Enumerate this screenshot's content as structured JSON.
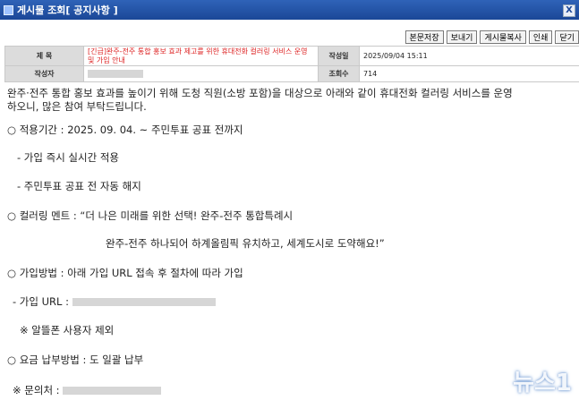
{
  "window": {
    "title": "게시물 조회[ 공지사항 ]",
    "close": "X"
  },
  "toolbar": {
    "buttons": [
      "본문저장",
      "보내기",
      "게시물복사",
      "인쇄",
      "닫기"
    ]
  },
  "info": {
    "title_label": "제 목",
    "title_value": "[긴급]완주-전주 통합 홍보 효과 제고를 위한 휴대전화 컬러링 서비스 운영 및 가입 안내",
    "date_label": "작성일",
    "date_value": "2025/09/04 15:11",
    "author_label": "작성자",
    "author_value": "",
    "views_label": "조회수",
    "views_value": "714"
  },
  "body": {
    "intro1": "완주·전주 통합 홍보 효과를 높이기 위해 도청 직원(소방 포함)을 대상으로 아래와 같이 휴대전화 컬러링 서비스를 운영",
    "intro2": "하오니, 많은 참여 부탁드립니다.",
    "period": "○ 적용기간 : 2025. 09. 04. ~ 주민투표 공표 전까지",
    "period_a": "- 가입 즉시 실시간 적용",
    "period_b": "- 주민투표 공표 전 자동 해지",
    "ment": "○ 컬러링 멘트 : “더 나은 미래를 위한 선택! 완주-전주 통합특례시",
    "ment2": "완주-전주 하나되어 하계올림픽 유치하고, 세계도시로 도약해요!”",
    "method": "○ 가입방법 : 아래 가입 URL 접속 후 절차에 따라 가입",
    "url_label": "- 가입 URL :",
    "note": "※ 알뜰폰 사용자 제외",
    "payment": "○ 요금 납부방법 : 도 일괄 납부",
    "contact": "※ 문의처 :"
  },
  "watermark": "뉴스1"
}
